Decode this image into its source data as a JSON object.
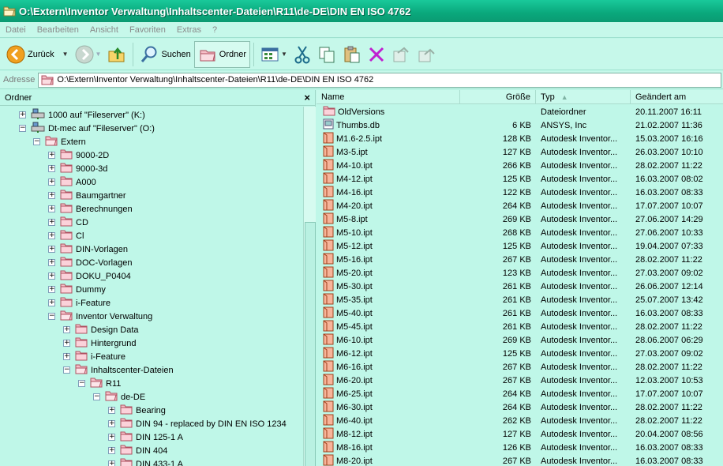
{
  "window": {
    "title": "O:\\Extern\\Inventor Verwaltung\\Inhaltscenter-Dateien\\R11\\de-DE\\DIN EN ISO 4762"
  },
  "menu": [
    "Datei",
    "Bearbeiten",
    "Ansicht",
    "Favoriten",
    "Extras",
    "?"
  ],
  "toolbar": {
    "back_label": "Zurück",
    "search_label": "Suchen",
    "folders_label": "Ordner"
  },
  "address": {
    "label": "Adresse",
    "value": "O:\\Extern\\Inventor Verwaltung\\Inhaltscenter-Dateien\\R11\\de-DE\\DIN EN ISO 4762"
  },
  "folders_pane": {
    "title": "Ordner",
    "close": "×",
    "tree": [
      {
        "label": "1000 auf \"Fileserver\" (K:)",
        "level": 0,
        "exp": "+",
        "icon": "drive"
      },
      {
        "label": "Dt-mec auf \"Fileserver\" (O:)",
        "level": 0,
        "exp": "−",
        "icon": "drive"
      },
      {
        "label": "Extern",
        "level": 1,
        "exp": "−",
        "icon": "folder-open"
      },
      {
        "label": "9000-2D",
        "level": 2,
        "exp": "+",
        "icon": "folder"
      },
      {
        "label": "9000-3d",
        "level": 2,
        "exp": "+",
        "icon": "folder"
      },
      {
        "label": "A000",
        "level": 2,
        "exp": "+",
        "icon": "folder"
      },
      {
        "label": "Baumgartner",
        "level": 2,
        "exp": "+",
        "icon": "folder"
      },
      {
        "label": "Berechnungen",
        "level": 2,
        "exp": "+",
        "icon": "folder"
      },
      {
        "label": "CD",
        "level": 2,
        "exp": "+",
        "icon": "folder"
      },
      {
        "label": "Cl",
        "level": 2,
        "exp": "+",
        "icon": "folder"
      },
      {
        "label": "DIN-Vorlagen",
        "level": 2,
        "exp": "+",
        "icon": "folder"
      },
      {
        "label": "DOC-Vorlagen",
        "level": 2,
        "exp": "+",
        "icon": "folder"
      },
      {
        "label": "DOKU_P0404",
        "level": 2,
        "exp": "+",
        "icon": "folder"
      },
      {
        "label": "Dummy",
        "level": 2,
        "exp": "+",
        "icon": "folder"
      },
      {
        "label": "i-Feature",
        "level": 2,
        "exp": "+",
        "icon": "folder"
      },
      {
        "label": "Inventor Verwaltung",
        "level": 2,
        "exp": "−",
        "icon": "folder-open"
      },
      {
        "label": "Design Data",
        "level": 3,
        "exp": "+",
        "icon": "folder"
      },
      {
        "label": "Hintergrund",
        "level": 3,
        "exp": "+",
        "icon": "folder"
      },
      {
        "label": "i-Feature",
        "level": 3,
        "exp": "+",
        "icon": "folder"
      },
      {
        "label": "Inhaltscenter-Dateien",
        "level": 3,
        "exp": "−",
        "icon": "folder-open"
      },
      {
        "label": "R11",
        "level": 4,
        "exp": "−",
        "icon": "folder-open"
      },
      {
        "label": "de-DE",
        "level": 5,
        "exp": "−",
        "icon": "folder-open"
      },
      {
        "label": "Bearing",
        "level": 6,
        "exp": "+",
        "icon": "folder"
      },
      {
        "label": "DIN 94 - replaced by DIN EN ISO 1234",
        "level": 6,
        "exp": "+",
        "icon": "folder"
      },
      {
        "label": "DIN 125-1  A",
        "level": 6,
        "exp": "+",
        "icon": "folder"
      },
      {
        "label": "DIN 404",
        "level": 6,
        "exp": "+",
        "icon": "folder"
      },
      {
        "label": "DIN 433-1  A",
        "level": 6,
        "exp": "+",
        "icon": "folder"
      }
    ]
  },
  "file_list": {
    "columns": {
      "name": "Name",
      "size": "Größe",
      "type": "Typ",
      "date": "Geändert am"
    },
    "rows": [
      {
        "name": "OldVersions",
        "size": "",
        "type": "Dateiordner",
        "date": "20.11.2007 16:11",
        "icon": "folder"
      },
      {
        "name": "Thumbs.db",
        "size": "6 KB",
        "type": "ANSYS, Inc",
        "date": "21.02.2007 11:36",
        "icon": "db"
      },
      {
        "name": "M1.6-2.5.ipt",
        "size": "128 KB",
        "type": "Autodesk Inventor...",
        "date": "15.03.2007 16:16",
        "icon": "ipt"
      },
      {
        "name": "M3-5.ipt",
        "size": "127 KB",
        "type": "Autodesk Inventor...",
        "date": "26.03.2007 10:10",
        "icon": "ipt"
      },
      {
        "name": "M4-10.ipt",
        "size": "266 KB",
        "type": "Autodesk Inventor...",
        "date": "28.02.2007 11:22",
        "icon": "ipt"
      },
      {
        "name": "M4-12.ipt",
        "size": "125 KB",
        "type": "Autodesk Inventor...",
        "date": "16.03.2007 08:02",
        "icon": "ipt"
      },
      {
        "name": "M4-16.ipt",
        "size": "122 KB",
        "type": "Autodesk Inventor...",
        "date": "16.03.2007 08:33",
        "icon": "ipt"
      },
      {
        "name": "M4-20.ipt",
        "size": "264 KB",
        "type": "Autodesk Inventor...",
        "date": "17.07.2007 10:07",
        "icon": "ipt"
      },
      {
        "name": "M5-8.ipt",
        "size": "269 KB",
        "type": "Autodesk Inventor...",
        "date": "27.06.2007 14:29",
        "icon": "ipt"
      },
      {
        "name": "M5-10.ipt",
        "size": "268 KB",
        "type": "Autodesk Inventor...",
        "date": "27.06.2007 10:33",
        "icon": "ipt"
      },
      {
        "name": "M5-12.ipt",
        "size": "125 KB",
        "type": "Autodesk Inventor...",
        "date": "19.04.2007 07:33",
        "icon": "ipt"
      },
      {
        "name": "M5-16.ipt",
        "size": "267 KB",
        "type": "Autodesk Inventor...",
        "date": "28.02.2007 11:22",
        "icon": "ipt"
      },
      {
        "name": "M5-20.ipt",
        "size": "123 KB",
        "type": "Autodesk Inventor...",
        "date": "27.03.2007 09:02",
        "icon": "ipt"
      },
      {
        "name": "M5-30.ipt",
        "size": "261 KB",
        "type": "Autodesk Inventor...",
        "date": "26.06.2007 12:14",
        "icon": "ipt"
      },
      {
        "name": "M5-35.ipt",
        "size": "261 KB",
        "type": "Autodesk Inventor...",
        "date": "25.07.2007 13:42",
        "icon": "ipt"
      },
      {
        "name": "M5-40.ipt",
        "size": "261 KB",
        "type": "Autodesk Inventor...",
        "date": "16.03.2007 08:33",
        "icon": "ipt"
      },
      {
        "name": "M5-45.ipt",
        "size": "261 KB",
        "type": "Autodesk Inventor...",
        "date": "28.02.2007 11:22",
        "icon": "ipt"
      },
      {
        "name": "M6-10.ipt",
        "size": "269 KB",
        "type": "Autodesk Inventor...",
        "date": "28.06.2007 06:29",
        "icon": "ipt"
      },
      {
        "name": "M6-12.ipt",
        "size": "125 KB",
        "type": "Autodesk Inventor...",
        "date": "27.03.2007 09:02",
        "icon": "ipt"
      },
      {
        "name": "M6-16.ipt",
        "size": "267 KB",
        "type": "Autodesk Inventor...",
        "date": "28.02.2007 11:22",
        "icon": "ipt"
      },
      {
        "name": "M6-20.ipt",
        "size": "267 KB",
        "type": "Autodesk Inventor...",
        "date": "12.03.2007 10:53",
        "icon": "ipt"
      },
      {
        "name": "M6-25.ipt",
        "size": "264 KB",
        "type": "Autodesk Inventor...",
        "date": "17.07.2007 10:07",
        "icon": "ipt"
      },
      {
        "name": "M6-30.ipt",
        "size": "264 KB",
        "type": "Autodesk Inventor...",
        "date": "28.02.2007 11:22",
        "icon": "ipt"
      },
      {
        "name": "M6-40.ipt",
        "size": "262 KB",
        "type": "Autodesk Inventor...",
        "date": "28.02.2007 11:22",
        "icon": "ipt"
      },
      {
        "name": "M8-12.ipt",
        "size": "127 KB",
        "type": "Autodesk Inventor...",
        "date": "20.04.2007 08:56",
        "icon": "ipt"
      },
      {
        "name": "M8-16.ipt",
        "size": "126 KB",
        "type": "Autodesk Inventor...",
        "date": "16.03.2007 08:33",
        "icon": "ipt"
      },
      {
        "name": "M8-20.ipt",
        "size": "267 KB",
        "type": "Autodesk Inventor...",
        "date": "16.03.2007 08:33",
        "icon": "ipt"
      }
    ]
  }
}
